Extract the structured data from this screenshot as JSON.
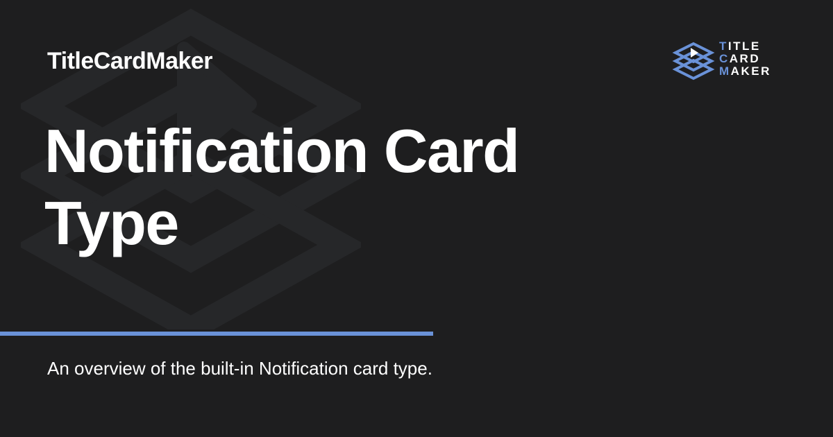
{
  "site": {
    "name": "TitleCardMaker"
  },
  "page": {
    "title_lines": [
      "Notification Card",
      "Type"
    ],
    "description": "An overview of the built-in Notification card type."
  },
  "logo": {
    "lines": [
      {
        "first": "T",
        "rest": "ITLE"
      },
      {
        "first": "C",
        "rest": "ARD"
      },
      {
        "first": "M",
        "rest": "AKER"
      }
    ]
  },
  "colors": {
    "background": "#1e1e1f",
    "accent": "#6a92d8",
    "watermark": "#262729",
    "text": "#ffffff"
  },
  "icons": {
    "background_mark": "layered-diamonds-play-icon",
    "logo_mark": "layered-diamonds-play-icon"
  }
}
